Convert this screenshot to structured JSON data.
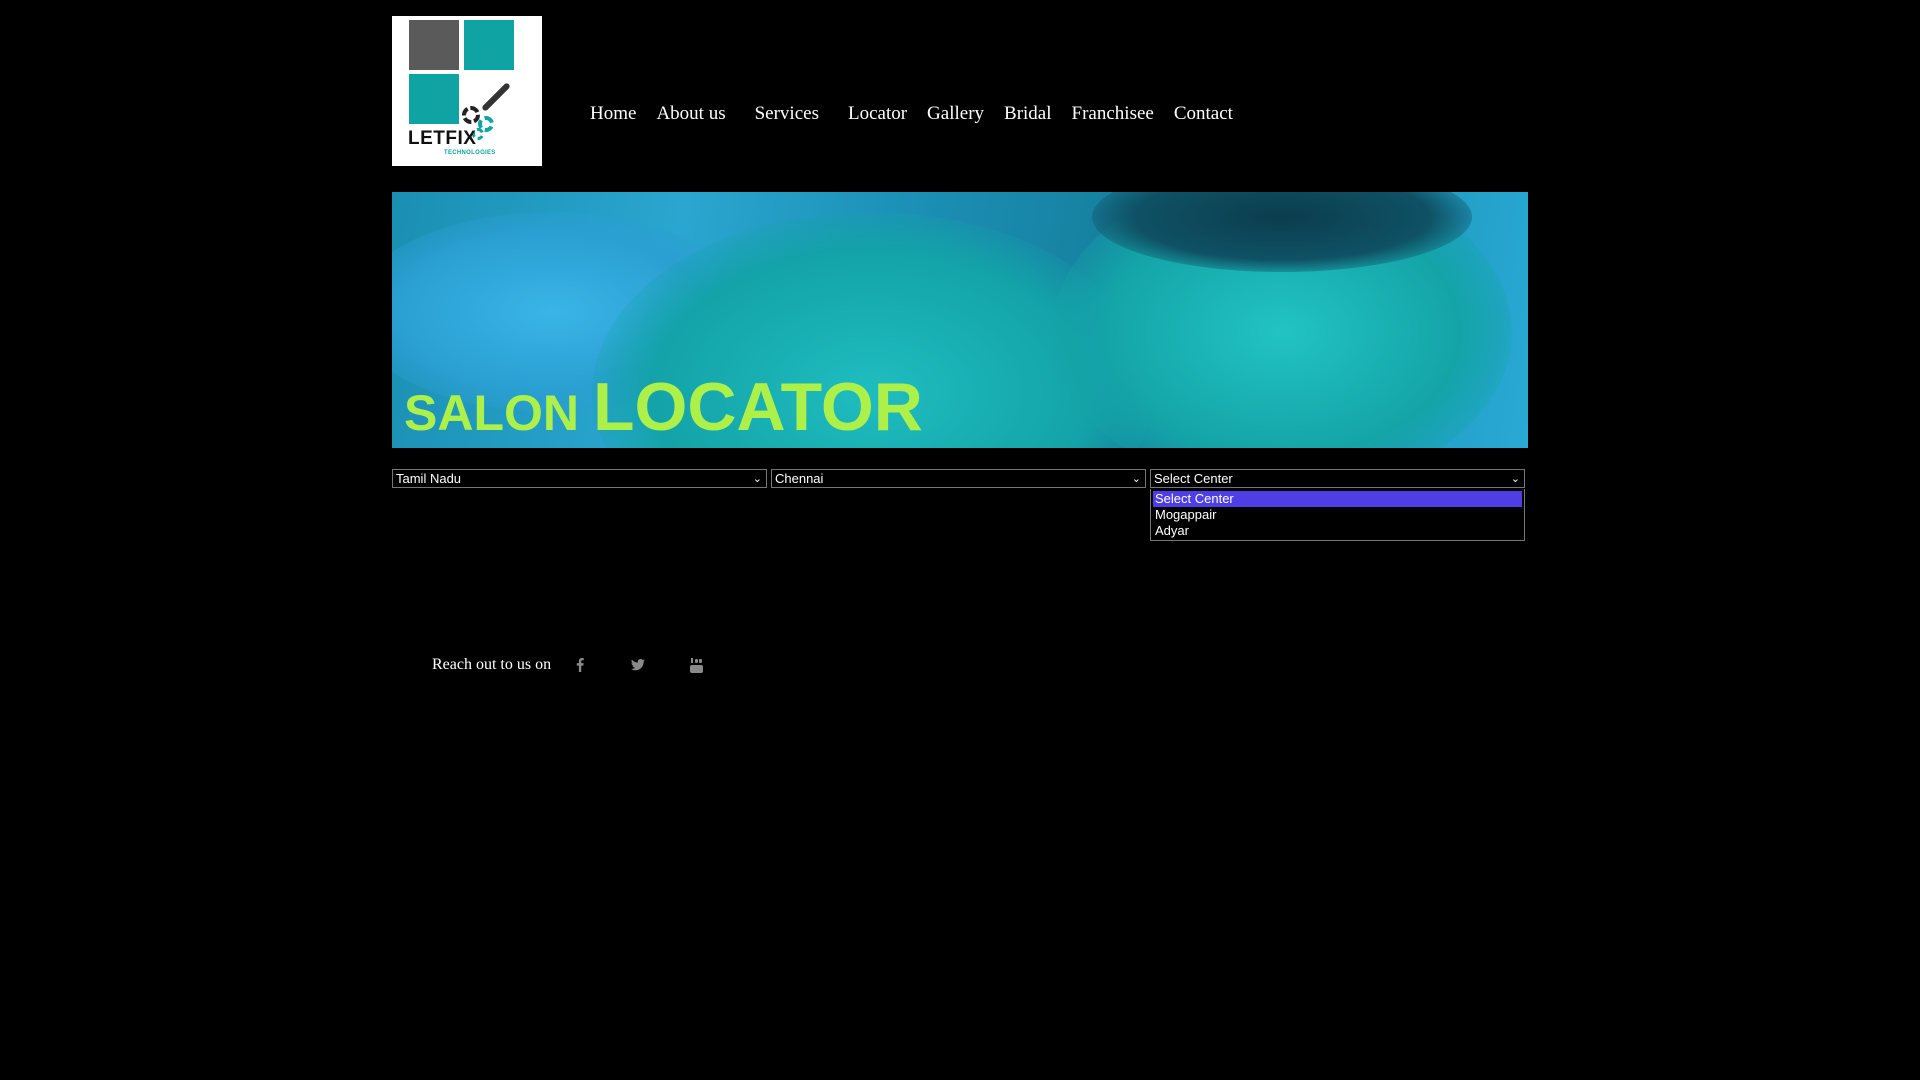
{
  "logo": {
    "brand": "LETFIX",
    "sub": "TECHNOLOGIES"
  },
  "nav": {
    "items": [
      {
        "label": "Home"
      },
      {
        "label": "About us"
      },
      {
        "label": "Services"
      },
      {
        "label": "Locator"
      },
      {
        "label": "Gallery"
      },
      {
        "label": "Bridal"
      },
      {
        "label": "Franchisee"
      },
      {
        "label": "Contact"
      }
    ]
  },
  "banner": {
    "title_small": "SALON",
    "title_big": "LOCATOR",
    "title_color": "#aef04a"
  },
  "locator": {
    "state_value": "Tamil Nadu",
    "city_value": "Chennai",
    "center_value": "Select Center",
    "center_options": [
      "Select Center",
      "Mogappair",
      "Adyar"
    ],
    "selected_option_color": "#4f3ee6"
  },
  "footer": {
    "reach_text": "Reach out to us on",
    "social": [
      "facebook-icon",
      "twitter-icon",
      "youtube-icon"
    ]
  }
}
